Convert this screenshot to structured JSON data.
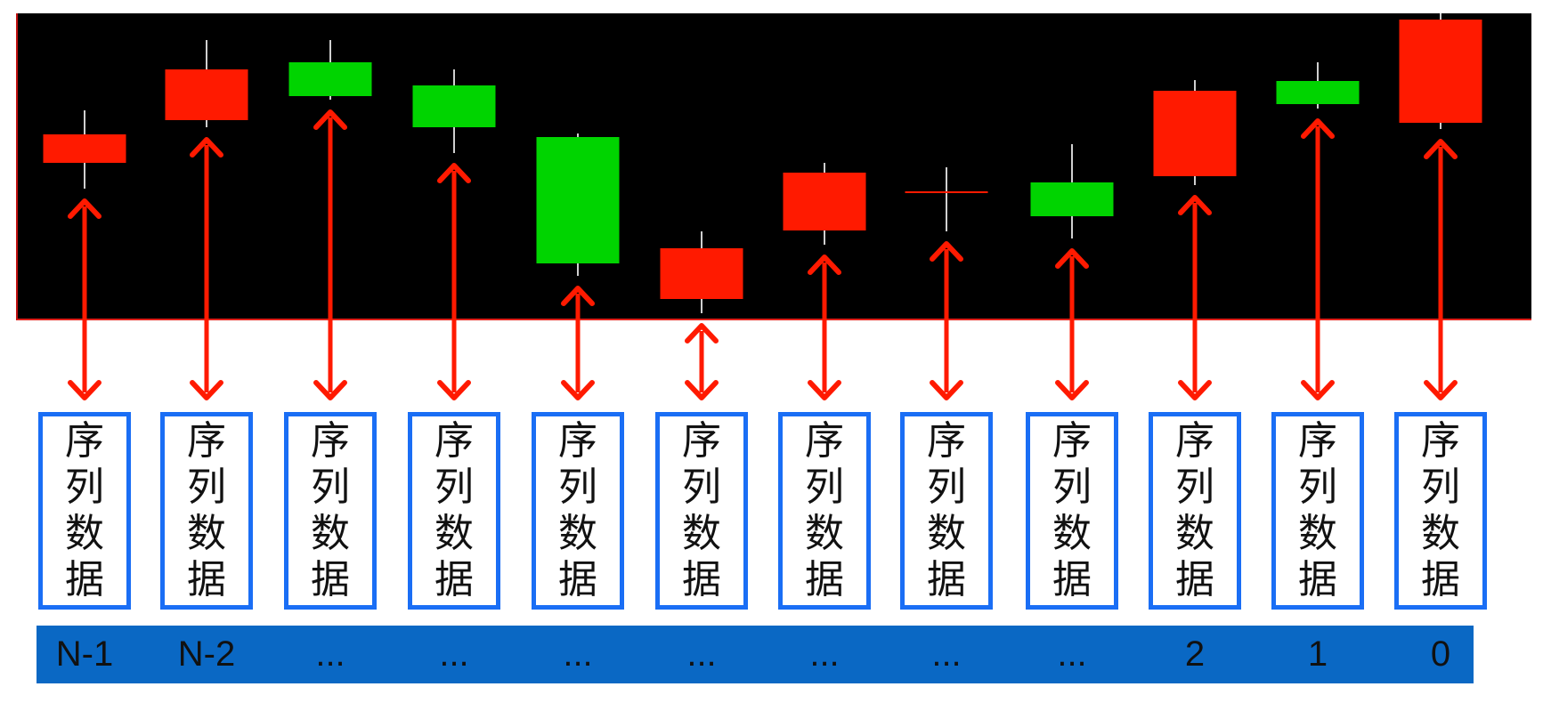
{
  "colors": {
    "up": "#ff1a00",
    "down": "#00d400",
    "wick": "#cfcfcf",
    "arrow": "#ff1a00",
    "box_border": "#1a6ef5",
    "index_bar": "#0a68c4"
  },
  "chart_data": {
    "type": "candlestick",
    "candles": [
      {
        "open": 175,
        "close": 207,
        "high": 234,
        "low": 146
      },
      {
        "open": 223,
        "close": 280,
        "high": 313,
        "low": 215
      },
      {
        "open": 288,
        "close": 250,
        "high": 313,
        "low": 246
      },
      {
        "open": 262,
        "close": 215,
        "high": 280,
        "low": 186
      },
      {
        "open": 204,
        "close": 62,
        "high": 208,
        "low": 48
      },
      {
        "open": 22,
        "close": 79,
        "high": 98,
        "low": 6
      },
      {
        "open": 99,
        "close": 164,
        "high": 175,
        "low": 83
      },
      {
        "open": 142,
        "close": 142,
        "high": 170,
        "low": 98
      },
      {
        "open": 153,
        "close": 115,
        "high": 196,
        "low": 90
      },
      {
        "open": 160,
        "close": 256,
        "high": 268,
        "low": 150
      },
      {
        "open": 267,
        "close": 241,
        "high": 288,
        "low": 236
      },
      {
        "open": 220,
        "close": 336,
        "high": 343,
        "low": 213
      }
    ]
  },
  "box_label_chars": [
    "序",
    "列",
    "数",
    "据"
  ],
  "index_labels": [
    "N-1",
    "N-2",
    "...",
    "...",
    "...",
    "...",
    "...",
    "...",
    "...",
    "2",
    "1",
    "0"
  ]
}
